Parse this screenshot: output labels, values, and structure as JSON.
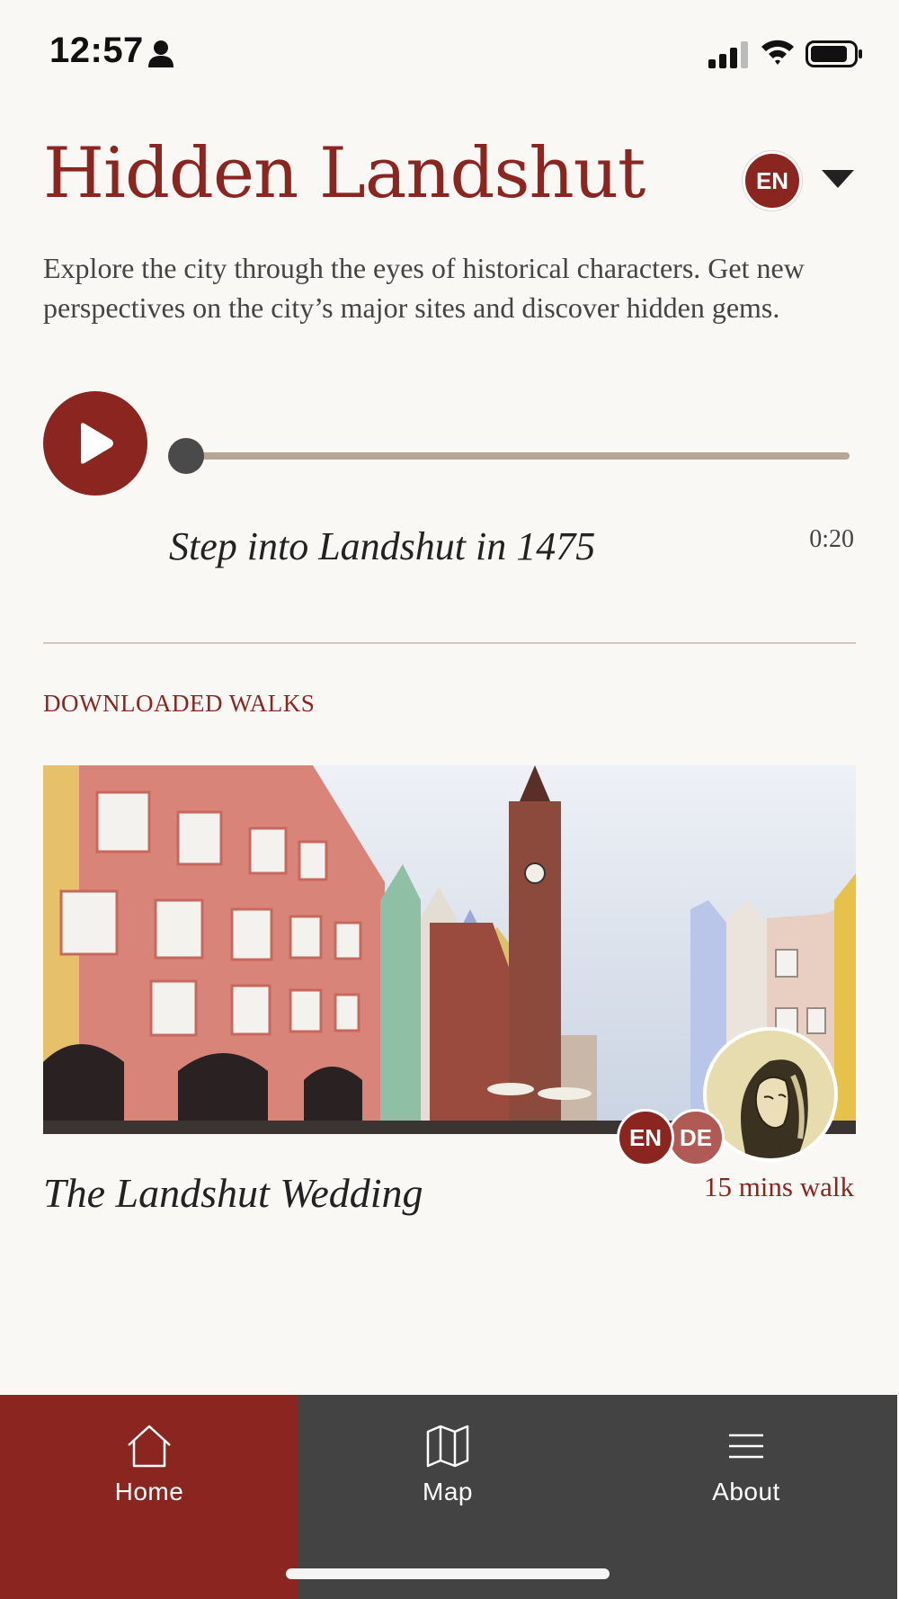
{
  "status_bar": {
    "time": "12:57"
  },
  "header": {
    "title": "Hidden Landshut",
    "language": "EN"
  },
  "intro": {
    "text": "Explore the city through the eyes of historical characters. Get new perspectives on the city’s major sites and discover hidden gems."
  },
  "player": {
    "track_title": "Step into Landshut in 1475",
    "time": "0:20",
    "progress": 0.0
  },
  "downloaded": {
    "section_label": "DOWNLOADED WALKS",
    "walks": [
      {
        "title": "The Landshut Wedding",
        "duration": "15 mins walk",
        "languages": [
          "EN",
          "DE"
        ]
      }
    ]
  },
  "nav": {
    "items": [
      {
        "label": "Home",
        "icon": "home-icon",
        "active": true
      },
      {
        "label": "Map",
        "icon": "map-icon",
        "active": false
      },
      {
        "label": "About",
        "icon": "menu-icon",
        "active": false
      }
    ]
  },
  "colors": {
    "accent": "#8b2520",
    "nav_bg": "#434343",
    "track": "#b8a594",
    "background": "#faf8f5"
  }
}
